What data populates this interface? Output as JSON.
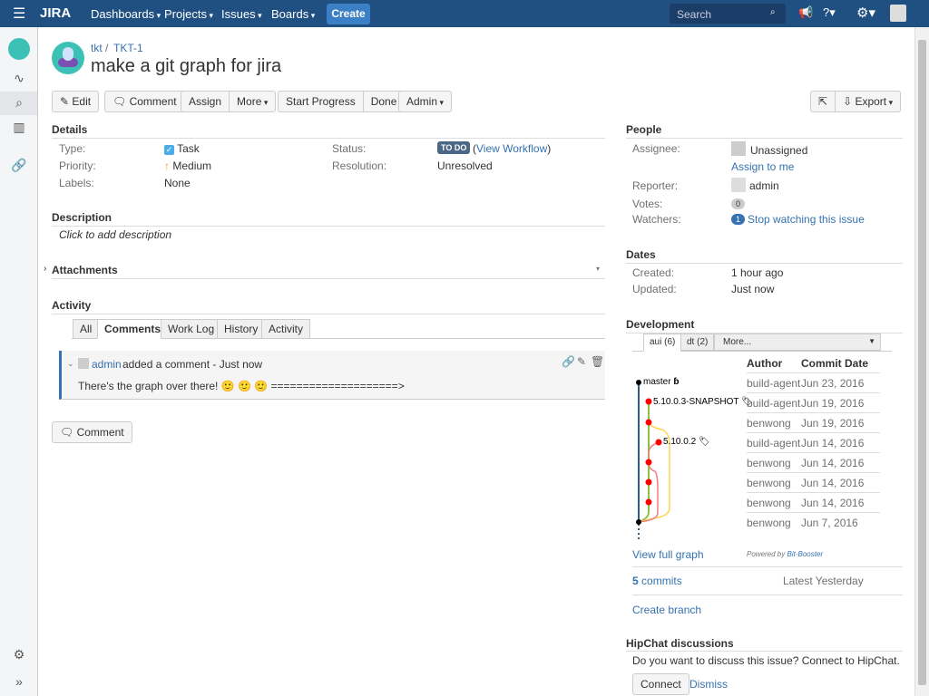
{
  "header": {
    "logo": "JIRA",
    "nav": [
      "Dashboards",
      "Projects",
      "Issues",
      "Boards"
    ],
    "create": "Create",
    "search_placeholder": "Search"
  },
  "issue": {
    "project": "tkt",
    "key": "TKT-1",
    "title": "make a git graph for jira"
  },
  "toolbar": {
    "edit": "Edit",
    "comment": "Comment",
    "assign": "Assign",
    "more": "More",
    "start_progress": "Start Progress",
    "done": "Done",
    "admin": "Admin",
    "export": "Export"
  },
  "details": {
    "heading": "Details",
    "type_label": "Type:",
    "type": "Task",
    "priority_label": "Priority:",
    "priority": "Medium",
    "labels_label": "Labels:",
    "labels": "None",
    "status_label": "Status:",
    "status": "TO DO",
    "view_workflow": "View Workflow",
    "resolution_label": "Resolution:",
    "resolution": "Unresolved"
  },
  "description": {
    "heading": "Description",
    "placeholder": "Click to add description"
  },
  "attachments": {
    "heading": "Attachments"
  },
  "activity": {
    "heading": "Activity",
    "tabs": [
      "All",
      "Comments",
      "Work Log",
      "History",
      "Activity"
    ],
    "comment": {
      "author": "admin",
      "action": "added a comment - Just now",
      "body": "There's the graph over there! 🙂 🙂 🙂 ====================>"
    },
    "comment_button": "Comment"
  },
  "people": {
    "heading": "People",
    "assignee_label": "Assignee:",
    "assignee": "Unassigned",
    "assign_to_me": "Assign to me",
    "reporter_label": "Reporter:",
    "reporter": "admin",
    "votes_label": "Votes:",
    "votes": "0",
    "watchers_label": "Watchers:",
    "watchers": "1",
    "stop_watching": "Stop watching this issue"
  },
  "dates": {
    "heading": "Dates",
    "created_label": "Created:",
    "created": "1 hour ago",
    "updated_label": "Updated:",
    "updated": "Just now"
  },
  "development": {
    "heading": "Development",
    "tabs": [
      "aui (6)",
      "dt (2)"
    ],
    "more": "More...",
    "refs": {
      "master": "master",
      "snapshot": "5.10.0.3-SNAPSHOT",
      "release": "5.10.0.2"
    },
    "columns": [
      "Author",
      "Commit Date"
    ],
    "commits": [
      [
        "build-agent",
        "Jun 23, 2016"
      ],
      [
        "build-agent",
        "Jun 19, 2016"
      ],
      [
        "benwong",
        "Jun 19, 2016"
      ],
      [
        "build-agent",
        "Jun 14, 2016"
      ],
      [
        "benwong",
        "Jun 14, 2016"
      ],
      [
        "benwong",
        "Jun 14, 2016"
      ],
      [
        "benwong",
        "Jun 14, 2016"
      ],
      [
        "benwong",
        "Jun 7, 2016"
      ]
    ],
    "view_full_graph": "View full graph",
    "powered_by": "Powered by",
    "powered_brand": "Bit-Booster",
    "commits_count": "5",
    "commits_word": "commits",
    "latest": "Latest Yesterday",
    "create_branch": "Create branch"
  },
  "hipchat": {
    "heading": "HipChat discussions",
    "text": "Do you want to discuss this issue? Connect to HipChat.",
    "connect": "Connect",
    "dismiss": "Dismiss"
  }
}
